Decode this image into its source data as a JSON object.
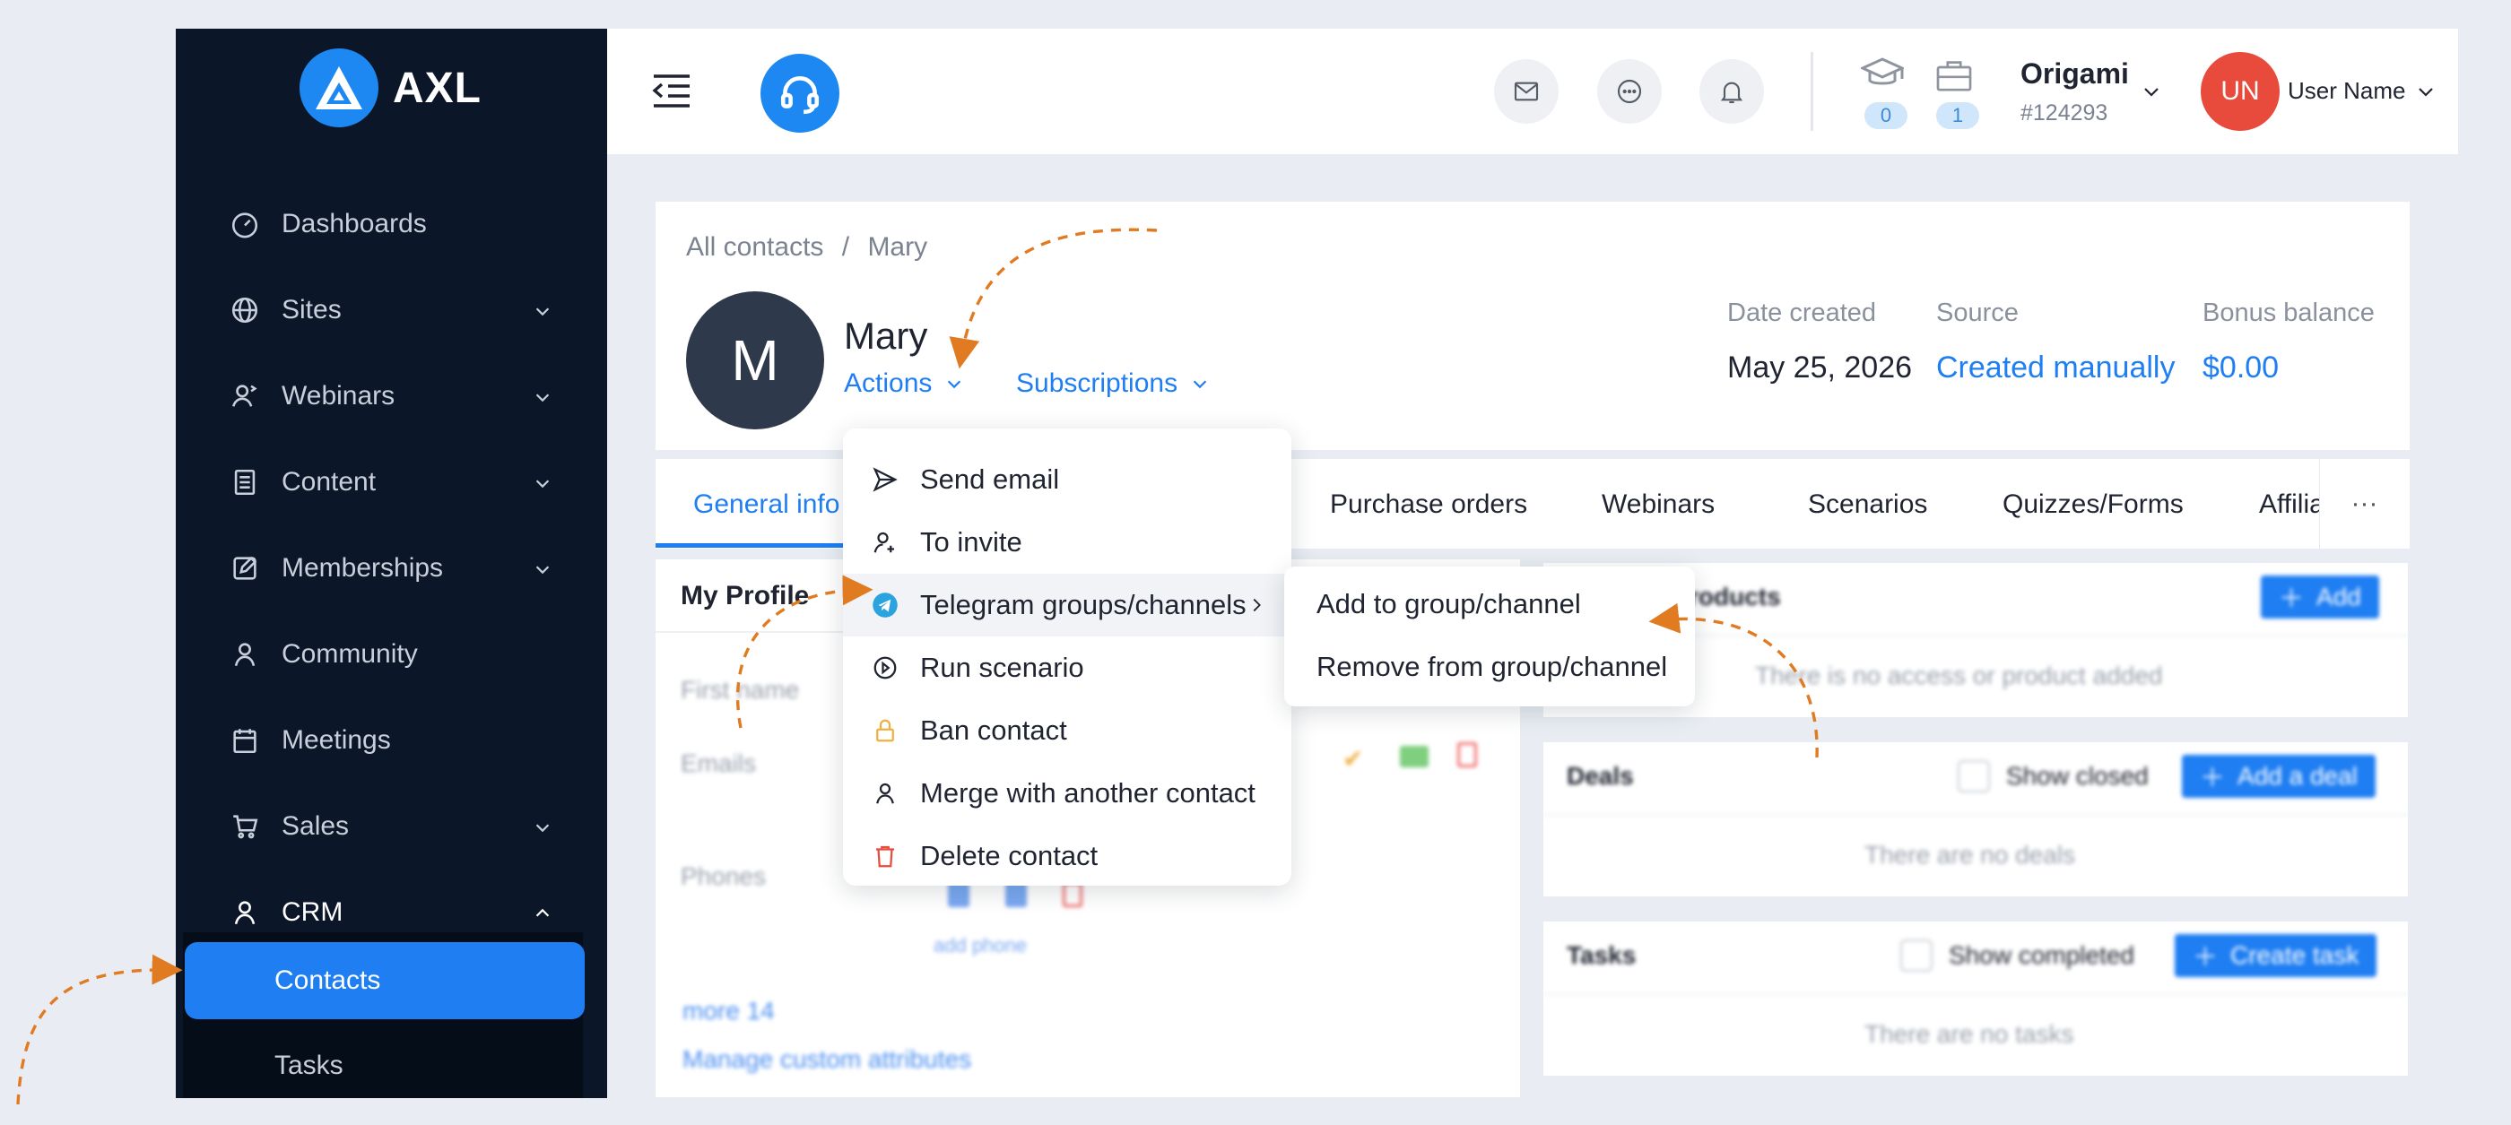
{
  "brand": {
    "name": "AXL"
  },
  "sidebar": {
    "items": [
      {
        "label": "Dashboards",
        "icon": "dashboard-icon",
        "chevron": ""
      },
      {
        "label": "Sites",
        "icon": "globe-icon",
        "chevron": "down"
      },
      {
        "label": "Webinars",
        "icon": "webinar-icon",
        "chevron": "down"
      },
      {
        "label": "Content",
        "icon": "content-icon",
        "chevron": "down"
      },
      {
        "label": "Memberships",
        "icon": "memberships-icon",
        "chevron": "down"
      },
      {
        "label": "Community",
        "icon": "community-icon",
        "chevron": ""
      },
      {
        "label": "Meetings",
        "icon": "calendar-icon",
        "chevron": ""
      },
      {
        "label": "Sales",
        "icon": "cart-icon",
        "chevron": "down"
      },
      {
        "label": "CRM",
        "icon": "user-icon",
        "chevron": "up"
      }
    ],
    "subitems": [
      {
        "label": "Contacts"
      },
      {
        "label": "Tasks"
      }
    ]
  },
  "header": {
    "badges": {
      "courses": "0",
      "orders": "1"
    },
    "org_name": "Origami",
    "org_id": "#124293",
    "user_initials": "UN",
    "user_name": "User Name"
  },
  "contact": {
    "breadcrumb_root": "All contacts",
    "breadcrumb_sep": "/",
    "breadcrumb_current": "Mary",
    "initial": "M",
    "name": "Mary",
    "actions_label": "Actions",
    "subscriptions_label": "Subscriptions",
    "meta": {
      "date_created_label": "Date created",
      "date_created": "May 25, 2026",
      "source_label": "Source",
      "source": "Created manually",
      "bonus_label": "Bonus balance",
      "bonus": "$0.00"
    }
  },
  "tabs": [
    "General info",
    "Purchase orders",
    "Webinars",
    "Scenarios",
    "Quizzes/Forms",
    "Affilia"
  ],
  "tabs_more": "···",
  "profile": {
    "title": "My Profile",
    "first_name_label": "First name",
    "emails_label": "Emails",
    "phones_label": "Phones",
    "add_phone": "add phone",
    "more": "more 14",
    "manage_attrs": "Manage custom attributes"
  },
  "products": {
    "title": "d products",
    "add": "Add",
    "empty": "There is no access or product added"
  },
  "deals": {
    "title": "Deals",
    "show_closed": "Show closed",
    "add": "Add a deal",
    "empty": "There are no deals"
  },
  "tasks_panel": {
    "title": "Tasks",
    "show_completed": "Show completed",
    "add": "Create task",
    "empty": "There are no tasks"
  },
  "actions_menu": [
    {
      "label": "Send email",
      "icon": "send-icon"
    },
    {
      "label": "To invite",
      "icon": "invite-user-icon"
    },
    {
      "label": "Telegram groups/channels",
      "icon": "telegram-icon"
    },
    {
      "label": "Run scenario",
      "icon": "play-circle-icon"
    },
    {
      "label": "Ban contact",
      "icon": "lock-icon"
    },
    {
      "label": "Merge with another contact",
      "icon": "merge-user-icon"
    },
    {
      "label": "Delete contact",
      "icon": "trash-icon"
    }
  ],
  "telegram_submenu": [
    {
      "label": "Add to group/channel"
    },
    {
      "label": "Remove from group/channel"
    }
  ],
  "colors": {
    "sidebar_bg": "#0b1729",
    "accent": "#1e7ef2",
    "annotation": "#e07b22",
    "danger": "#e84a3c"
  }
}
